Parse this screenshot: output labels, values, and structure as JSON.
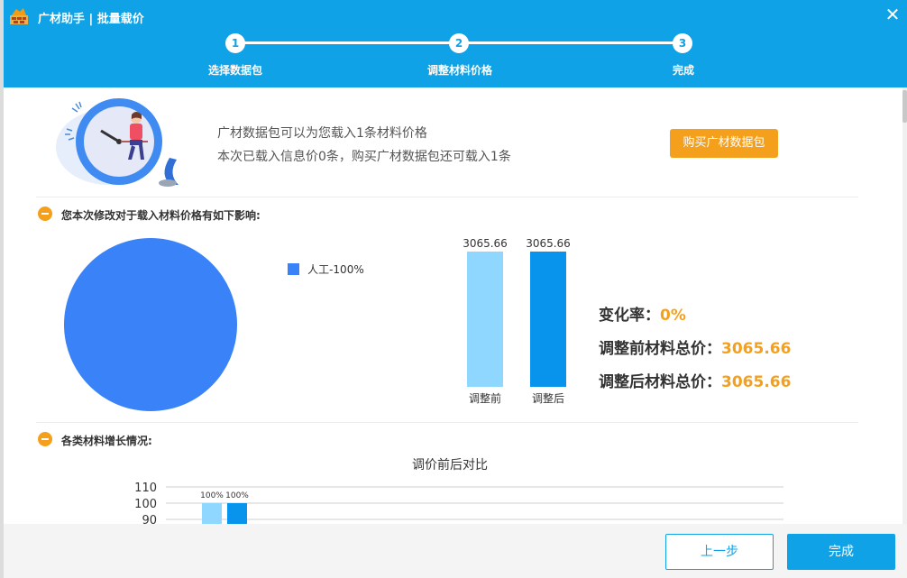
{
  "window": {
    "title": "广材助手 | 批量载价",
    "close_icon": "close-icon",
    "app_icon": "app-logo-icon"
  },
  "steps": [
    {
      "number": "1",
      "label": "选择数据包"
    },
    {
      "number": "2",
      "label": "调整材料价格"
    },
    {
      "number": "3",
      "label": "完成"
    }
  ],
  "info": {
    "line1": "广材数据包可以为您载入1条材料价格",
    "line2": "本次已载入信息价0条，购买广材数据包还可载入1条",
    "buy_label": "购买广材数据包",
    "illustration_icon": "clock-illustration-icon"
  },
  "section1": {
    "title": "您本次修改对于载入材料价格有如下影响:",
    "pie": {
      "legend": "人工-100%",
      "value": 100,
      "color": "#3a82f7"
    },
    "bars": [
      {
        "label": "调整前",
        "value": 3065.66,
        "value_text": "3065.66",
        "color": "#8fd7ff"
      },
      {
        "label": "调整后",
        "value": 3065.66,
        "value_text": "3065.66",
        "color": "#0893ec"
      }
    ],
    "stats": {
      "change_label": "变化率：",
      "change_value": "0%",
      "before_label": "调整前材料总价：",
      "before_value": "3065.66",
      "after_label": "调整后材料总价：",
      "after_value": "3065.66"
    }
  },
  "section2": {
    "title": "各类材料增长情况:"
  },
  "chart_data": {
    "type": "bar",
    "title": "调价前后对比",
    "y_ticks": [
      "110",
      "100",
      "90"
    ],
    "ylim": [
      90,
      110
    ],
    "series": [
      {
        "values": [
          100
        ],
        "labels": [
          "100%"
        ],
        "color": "#8fd7ff"
      },
      {
        "values": [
          100
        ],
        "labels": [
          "100%"
        ],
        "color": "#0893ec"
      }
    ]
  },
  "footer": {
    "prev_label": "上一步",
    "done_label": "完成"
  },
  "colors": {
    "header": "#0fa2e6",
    "accent": "#f5a01c"
  }
}
